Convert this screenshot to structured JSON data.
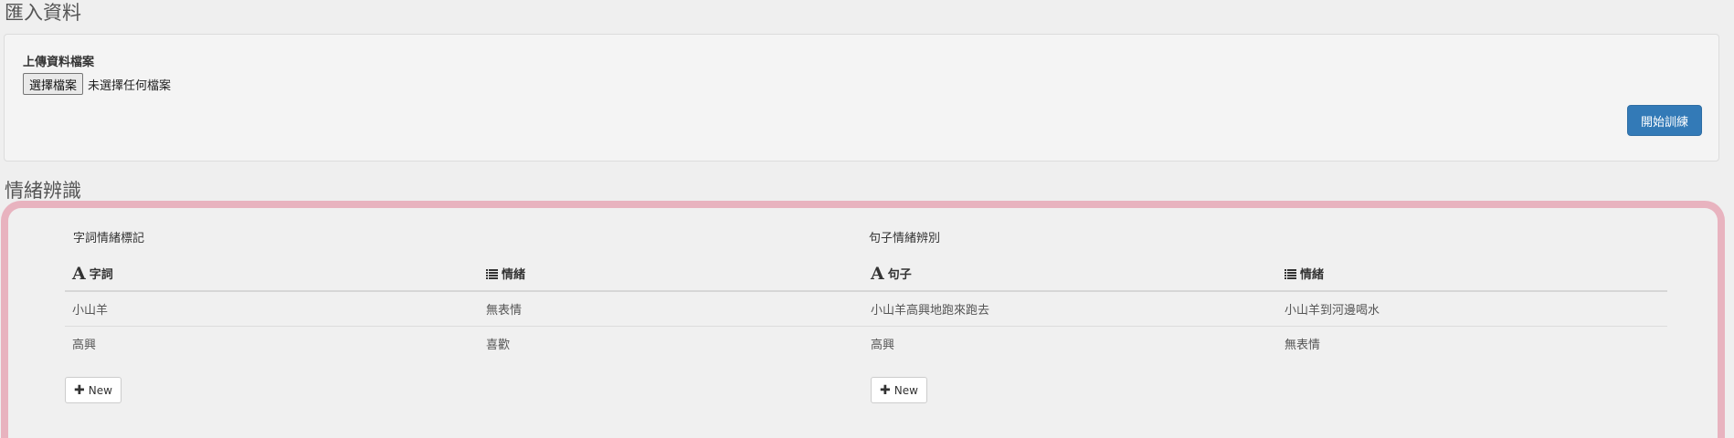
{
  "import": {
    "heading": "匯入資料",
    "upload_label": "上傳資料檔案",
    "file_button": "選擇檔案",
    "file_status": "未選擇任何檔案",
    "train_button": "開始訓練"
  },
  "emotion": {
    "heading": "情緒辨識",
    "word_table": {
      "title": "字詞情緒標記",
      "headers": [
        "字詞",
        "情緒"
      ],
      "header_icons": [
        "font-icon",
        "list-icon"
      ],
      "rows": [
        [
          "小山羊",
          "無表情"
        ],
        [
          "高興",
          "喜歡"
        ]
      ],
      "new_button": "New"
    },
    "sentence_table": {
      "title": "句子情緒辨別",
      "headers": [
        "句子",
        "情緒"
      ],
      "header_icons": [
        "font-icon",
        "list-icon"
      ],
      "rows": [
        [
          "小山羊高興地跑來跑去",
          "小山羊到河邊喝水"
        ],
        [
          "高興",
          "無表情"
        ]
      ],
      "new_button": "New"
    }
  },
  "colors": {
    "primary_button": "#337ab7",
    "panel_border_accent": "#e8b3bf"
  }
}
